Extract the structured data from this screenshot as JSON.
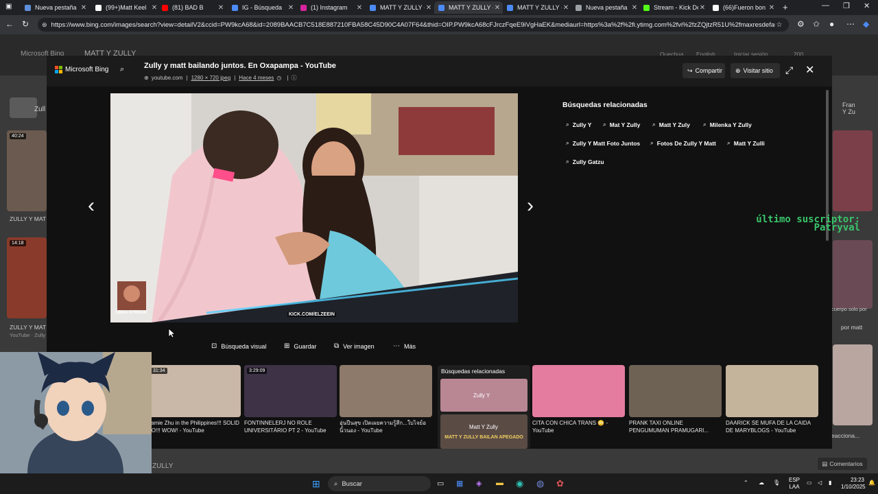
{
  "browser": {
    "tabs": [
      {
        "label": "Nueva pestaña",
        "color": "#5f8fd9"
      },
      {
        "label": "(99+)Matt Keel",
        "color": "#ffffff"
      },
      {
        "label": "(81) BAD B",
        "color": "#ff0000"
      },
      {
        "label": "IG - Búsqueda",
        "color": "#4c8bf5"
      },
      {
        "label": "(1) Instagram",
        "color": "#d6249f"
      },
      {
        "label": "MATT Y ZULLY -",
        "color": "#4c8bf5"
      },
      {
        "label": "MATT Y ZULLY -",
        "color": "#4c8bf5"
      },
      {
        "label": "MATT Y ZULLY -",
        "color": "#4c8bf5"
      },
      {
        "label": "Nueva pestaña",
        "color": "#9aa0a6"
      },
      {
        "label": "Stream - Kick De",
        "color": "#53fc18"
      },
      {
        "label": "(66)Fueron bon",
        "color": "#ffffff"
      }
    ],
    "close_glyph": "✕",
    "new_tab": "+",
    "url": "https://www.bing.com/images/search?view=detailV2&ccid=PW9kcA68&id=2089BAACB7C518E887210FBA58C45D90C4A07F64&thid=OIP.PW9kcA68cFJrczFqeE9iVgHaEK&mediaurl=https%3a%2f%2fi.ytimg.com%2fvi%2fzZQjtzR51U%2fmaxresdefault.jpg..."
  },
  "bg_page": {
    "logo": "Microsoft Bing",
    "query": "MATT Y ZULLY",
    "header_links": [
      "Quechua",
      "English",
      "Iniciar sesión",
      "200"
    ],
    "left_captions": [
      "ZULLY Y MAT",
      "ZULLY Y MAT",
      "YouTube · Zully"
    ],
    "left_badges": [
      "40:24",
      "14:18"
    ],
    "right_captions": [
      "cuerpo solo por",
      "por matt",
      "eacciona..."
    ],
    "bottom_query": "ZULLY",
    "feedback": "Comentarios",
    "top_left_snippet": "Zull",
    "top_right_snippet": "Fran Y Zu"
  },
  "modal": {
    "logo_text": "Microsoft Bing",
    "title": "Zully y matt bailando juntos. En Oxapampa - YouTube",
    "source": "youtube.com",
    "dimensions": "1280 × 720 jpeg",
    "age": "Hace 4 meses",
    "sep": "|",
    "share_label": "Compartir",
    "visit_label": "Visitar sitio",
    "related_title": "Búsquedas relacionadas",
    "related_chips": [
      "Zully Y",
      "Mat Y Zully",
      "Matt Y Zuly",
      "Milenka Y Zully",
      "Zully Y Matt Foto Juntos",
      "Fotos De Zully Y Matt",
      "Matt Y Zulli",
      "Zully Gatzu"
    ],
    "image_overlay_streak": "1284x STREAK",
    "image_overlay_kick": "KICK.COM/ELZEEIN",
    "stream_overlay_line1": "último suscriptor:",
    "stream_overlay_line2": "Patryval",
    "actions": [
      {
        "icon": "visual-search-icon",
        "label": "Búsqueda visual"
      },
      {
        "icon": "save-icon",
        "label": "Guardar"
      },
      {
        "icon": "view-image-icon",
        "label": "Ver imagen"
      },
      {
        "icon": "more-icon",
        "label": "Más"
      }
    ],
    "strip": [
      {
        "badge": "31:34",
        "caption": "Jamie Zhu in the Philippines!!! SOLID TO!!! WOW! - YouTube",
        "color": "#c9b7a8"
      },
      {
        "badge": "3:29:09",
        "caption": "FONTINNELERJ NO ROLE UNIVERSITÁRIO PT 2 - YouTube",
        "color": "#3d3246"
      },
      {
        "badge": "",
        "caption": "อุ่นปีนสุข เปิดเผยความรู้สึก...ใบไจย์อนิ้วนอง - YouTube",
        "color": "#8d7a6a"
      },
      {
        "badge": "",
        "caption": "CITA CON CHICA TRANS 😳 - YouTube",
        "color": "#e47ca0"
      },
      {
        "badge": "",
        "caption": "PRANK TAXI ONLINE PENGUMUMAN PRAMUGARI...",
        "color": "#6e6255"
      },
      {
        "badge": "",
        "caption": "DAARICK SE MUFA DE LA CAIDA DE MARYBLOGS - YouTube",
        "color": "#c5b49c"
      }
    ],
    "related_tile": {
      "title": "Búsquedas relacionadas",
      "labels": [
        "Zully Y",
        "Matt Y Zully"
      ],
      "caption": "MATT Y ZULLY BAILAN APEGADO"
    }
  },
  "taskbar": {
    "search_label": "Buscar",
    "lang_top": "ESP",
    "lang_bottom": "LAA",
    "time": "23:23",
    "date": "1/10/2025"
  }
}
